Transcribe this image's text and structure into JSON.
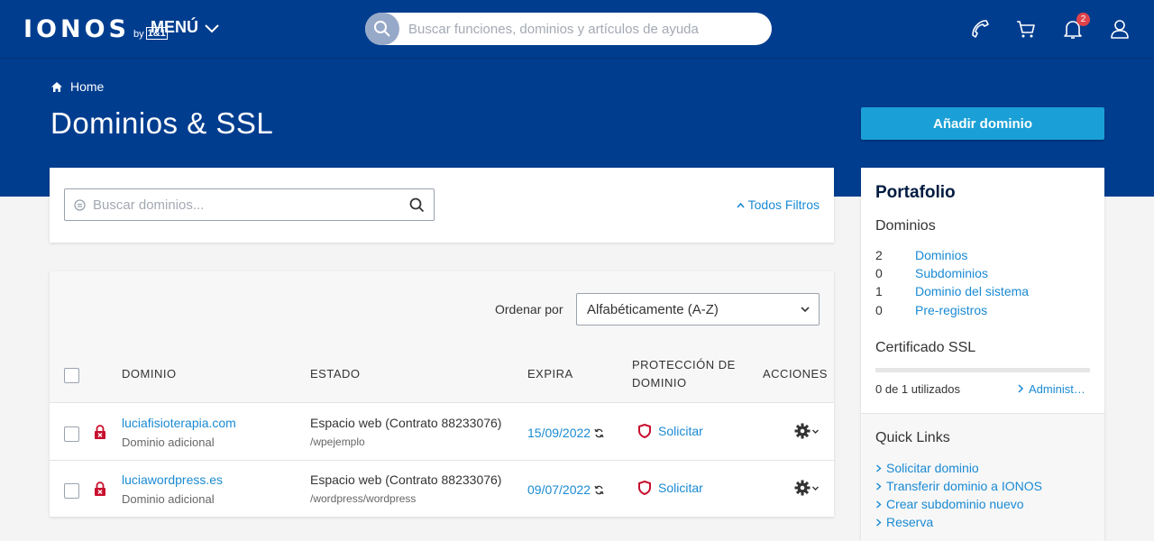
{
  "header": {
    "logo_text": "IONOS",
    "logo_by": "by",
    "logo_brand": "1&1",
    "menu_label": "MENÚ",
    "search_placeholder": "Buscar funciones, dominios y artículos de ayuda",
    "notifications_count": "2"
  },
  "hero": {
    "breadcrumb": "Home",
    "title": "Dominios & SSL",
    "add_domain_label": "Añadir dominio"
  },
  "filters": {
    "search_placeholder": "Buscar dominios...",
    "all_filters_label": "Todos Filtros"
  },
  "table": {
    "sort_label": "Ordenar por",
    "sort_value": "Alfabéticamente (A-Z)",
    "headers": {
      "domain": "DOMINIO",
      "status": "ESTADO",
      "expires": "EXPIRA",
      "protection_line1": "PROTECCIÓN DE",
      "protection_line2": "DOMINIO",
      "actions": "ACCIONES"
    },
    "rows": [
      {
        "domain": "luciafisioterapia.com",
        "type": "Dominio adicional",
        "status": "Espacio web (Contrato 88233076)",
        "path": "/wpejemplo",
        "expires": "15/09/2022",
        "protection": "Solicitar"
      },
      {
        "domain": "luciawordpress.es",
        "type": "Dominio adicional",
        "status": "Espacio web (Contrato 88233076)",
        "path": "/wordpress/wordpress",
        "expires": "09/07/2022",
        "protection": "Solicitar"
      }
    ]
  },
  "sidebar": {
    "title": "Portafolio",
    "domains_heading": "Dominios",
    "items": [
      {
        "count": "2",
        "label": "Dominios"
      },
      {
        "count": "0",
        "label": "Subdominios"
      },
      {
        "count": "1",
        "label": "Dominio del sistema"
      },
      {
        "count": "0",
        "label": "Pre-registros"
      }
    ],
    "ssl_heading": "Certificado SSL",
    "ssl_used": "0 de 1 utilizados",
    "ssl_used_fraction": 0,
    "ssl_admin": "Administ…",
    "quick_links_title": "Quick Links",
    "quick_links": [
      "Solicitar dominio",
      "Transferir dominio a IONOS",
      "Crear subdominio nuevo",
      "Reserva"
    ]
  },
  "colors": {
    "brand_blue": "#003d8f",
    "accent_cyan": "#1aa0d6",
    "link_blue": "#1a8ad3",
    "alert_red": "#c8102e"
  }
}
